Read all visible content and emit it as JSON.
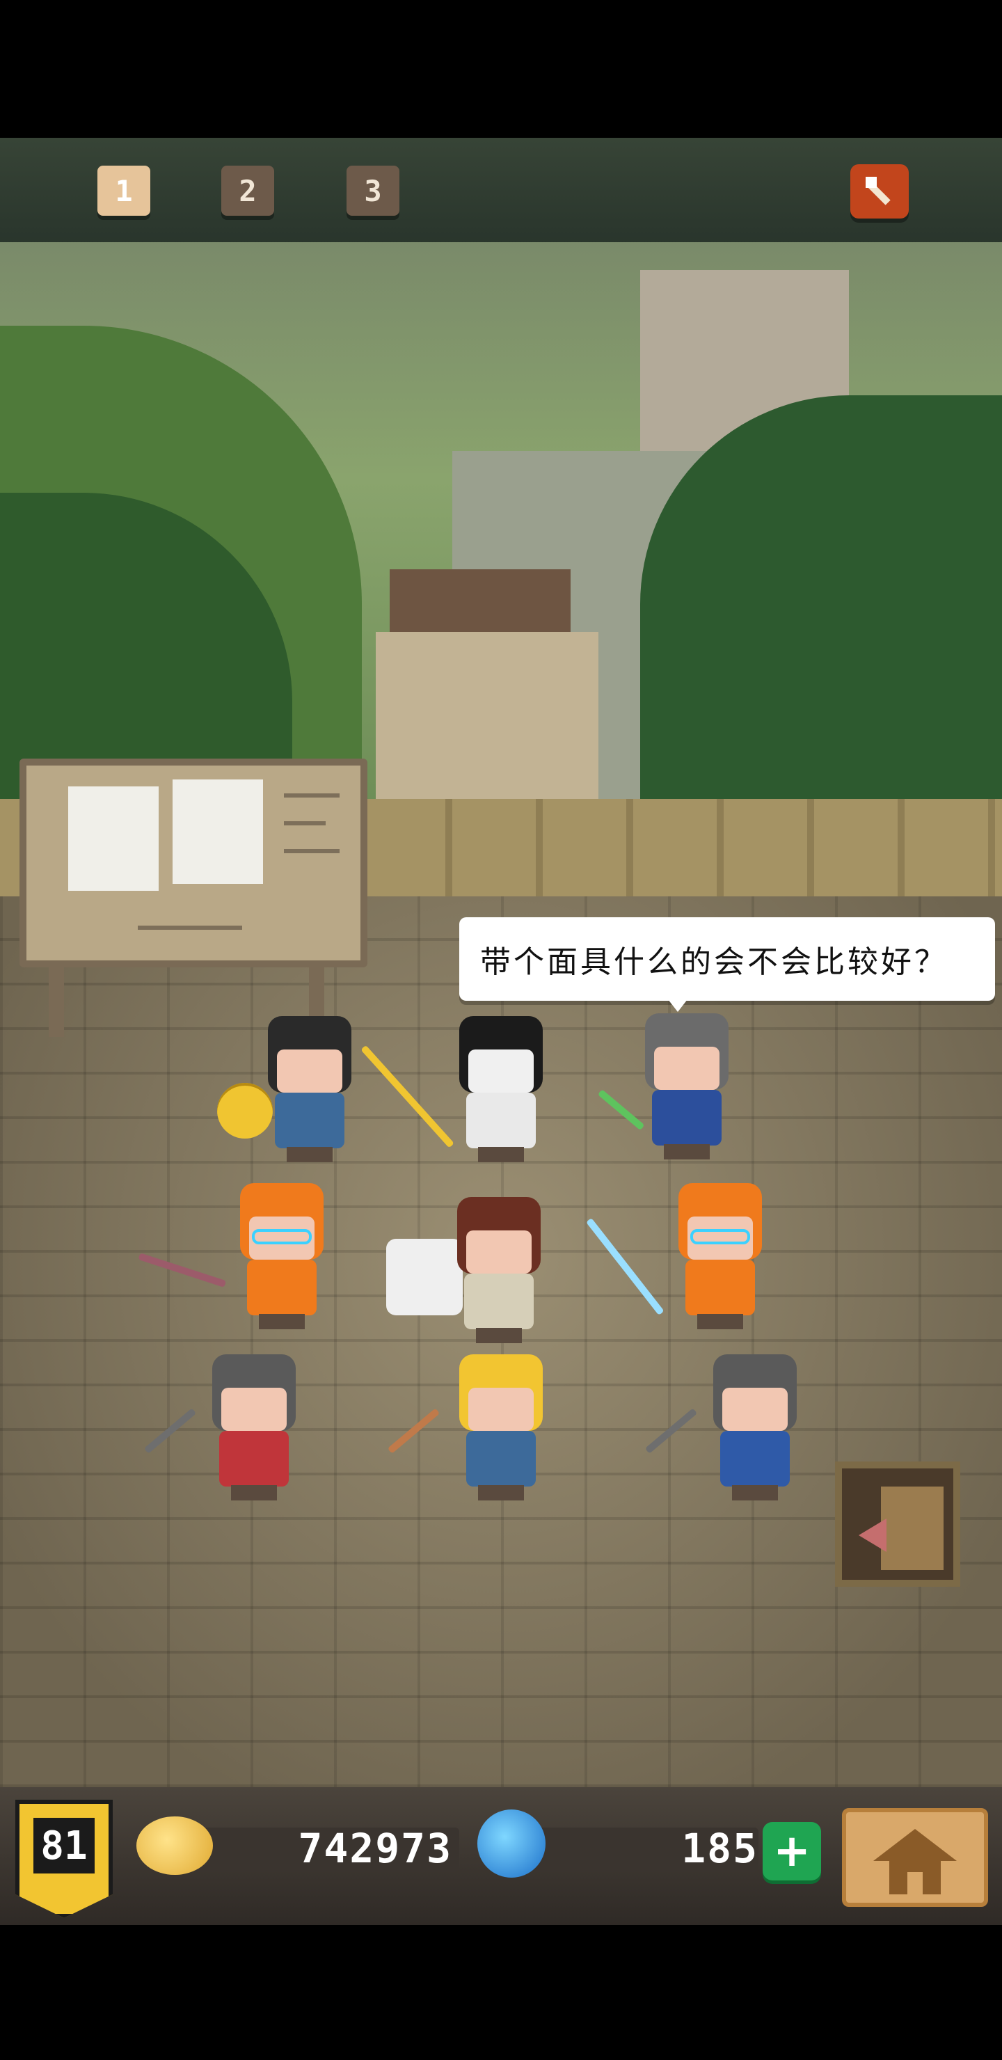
{
  "party_slots": [
    "1",
    "2",
    "3"
  ],
  "active_slot": "1",
  "speech_bubble": "带个面具什么的会不会比较好？",
  "heroes": [
    {
      "role": "black-hair-fighter",
      "hair": "#2a2a2a",
      "outfit": "#3d6a9a"
    },
    {
      "role": "samurai-helmet-knight",
      "hair": "#1b1b1b",
      "outfit": "#e9e9e9"
    },
    {
      "role": "gray-hair-farmer",
      "hair": "#6b6b6b",
      "outfit": "#2c4f9c"
    },
    {
      "role": "orange-hair-goggles-chef",
      "hair": "#f07a1c",
      "outfit": "#f07a1c"
    },
    {
      "role": "nurse",
      "hair": "#6b2f22",
      "outfit": "#d6cfb8"
    },
    {
      "role": "orange-hair-goggles-mage",
      "hair": "#f07a1c",
      "outfit": "#f07a1c"
    },
    {
      "role": "helmet-crossbow-red",
      "hair": "#5a5a5a",
      "outfit": "#c0353a"
    },
    {
      "role": "yellow-helmet-archer",
      "hair": "#f2c531",
      "outfit": "#3d6a9a"
    },
    {
      "role": "helmet-crossbow-blue",
      "hair": "#5a5a5a",
      "outfit": "#2f5aa8"
    }
  ],
  "resources": {
    "level": "81",
    "coins": "742973",
    "gems": "185"
  },
  "icons": {
    "quest": "scroll-sword-icon",
    "coin": "coin-stack-icon",
    "gem": "blue-gem-icon",
    "plus": "plus-icon",
    "home": "home-icon",
    "exit": "stairs-exit-icon"
  },
  "colors": {
    "active_slot": "#e6c49a",
    "inactive_slot": "#6d5a4a",
    "plus_button": "#1fa552",
    "level_badge": "#f2c531"
  }
}
